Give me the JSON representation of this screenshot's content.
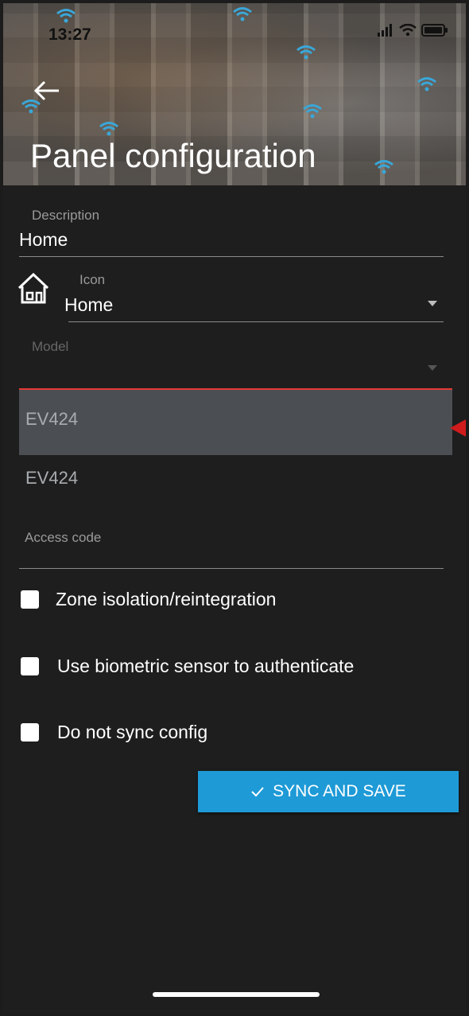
{
  "status_bar": {
    "time": "13:27"
  },
  "header": {
    "title": "Panel configuration"
  },
  "form": {
    "description": {
      "label": "Description",
      "value": "Home"
    },
    "icon": {
      "label": "Icon",
      "value": "Home"
    },
    "model": {
      "label": "Model",
      "value": ""
    },
    "model_options": [
      "EV424",
      "EV424"
    ],
    "access_code": {
      "label": "Access code",
      "value": ""
    }
  },
  "checkboxes": [
    {
      "label": "Zone isolation/reintegration",
      "checked": false
    },
    {
      "label": "Use biometric sensor to authenticate",
      "checked": false
    },
    {
      "label": "Do not sync config",
      "checked": false
    }
  ],
  "sync_button": {
    "label": "SYNC AND SAVE",
    "icon": "check-icon"
  },
  "colors": {
    "accent": "#1e9ad6",
    "error_line": "#e53935",
    "pointer": "#d01c1c"
  }
}
